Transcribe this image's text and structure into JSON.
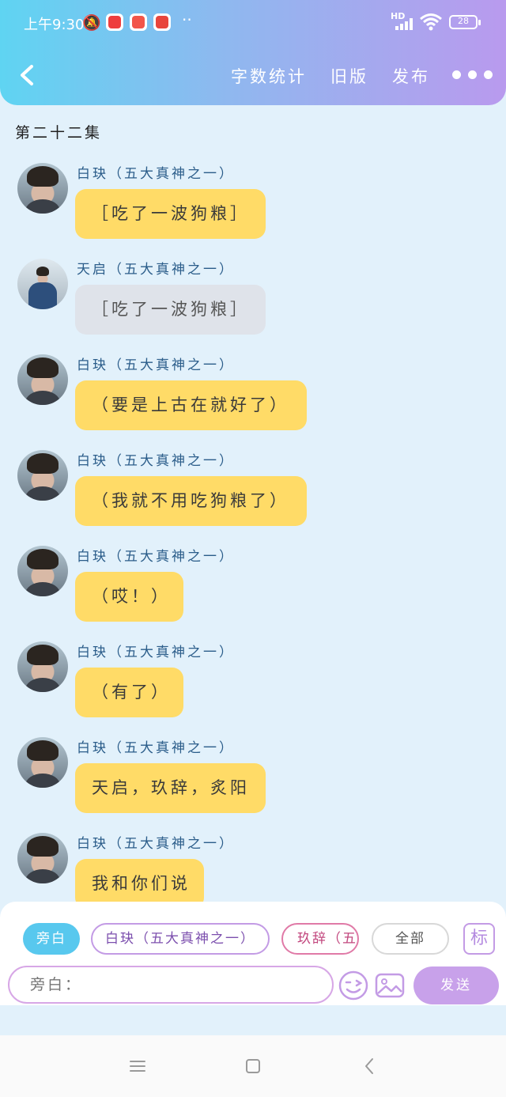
{
  "status_bar": {
    "time": "上午9:30",
    "network": "HD",
    "battery": "28",
    "apps": [
      {
        "name": "video-app-icon",
        "color": "#ee3e3e"
      },
      {
        "name": "shop-app-icon",
        "color": "#f2554a"
      },
      {
        "name": "mall-app-icon",
        "color": "#e8453c"
      }
    ]
  },
  "header": {
    "nav": [
      "字数统计",
      "旧版",
      "发布"
    ]
  },
  "chapter_title": "第二十二集",
  "messages": [
    {
      "speaker": "白玦（五大真神之一）",
      "text": "［吃了一波狗粮］",
      "style": "yellow",
      "avatar": "baijue"
    },
    {
      "speaker": "天启（五大真神之一）",
      "text": "［吃了一波狗粮］",
      "style": "grey",
      "avatar": "tianqi"
    },
    {
      "speaker": "白玦（五大真神之一）",
      "text": "（要是上古在就好了）",
      "style": "yellow",
      "avatar": "baijue"
    },
    {
      "speaker": "白玦（五大真神之一）",
      "text": "（我就不用吃狗粮了）",
      "style": "yellow",
      "avatar": "baijue"
    },
    {
      "speaker": "白玦（五大真神之一）",
      "text": "（哎！）",
      "style": "yellow",
      "avatar": "baijue"
    },
    {
      "speaker": "白玦（五大真神之一）",
      "text": "（有了）",
      "style": "yellow",
      "avatar": "baijue"
    },
    {
      "speaker": "白玦（五大真神之一）",
      "text": "天启，玖辞，炙阳",
      "style": "yellow",
      "avatar": "baijue"
    },
    {
      "speaker": "白玦（五大真神之一）",
      "text": "我和你们说",
      "style": "yellow",
      "avatar": "baijue"
    }
  ],
  "role_chips": [
    {
      "label": "旁白",
      "style": "active"
    },
    {
      "label": "白玦（五大真神之一）",
      "style": "purple"
    },
    {
      "label": "玖辞（五大真神之一）",
      "style": "pink"
    },
    {
      "label": "全部",
      "style": "plain"
    }
  ],
  "tag_button": "标",
  "input": {
    "placeholder": "旁白："
  },
  "send_label": "发送",
  "colors": {
    "accent_blue": "#58c8ee",
    "accent_purple": "#c8a1ea",
    "bubble_yellow": "#ffdb67",
    "bubble_grey": "#dfe3ea"
  }
}
